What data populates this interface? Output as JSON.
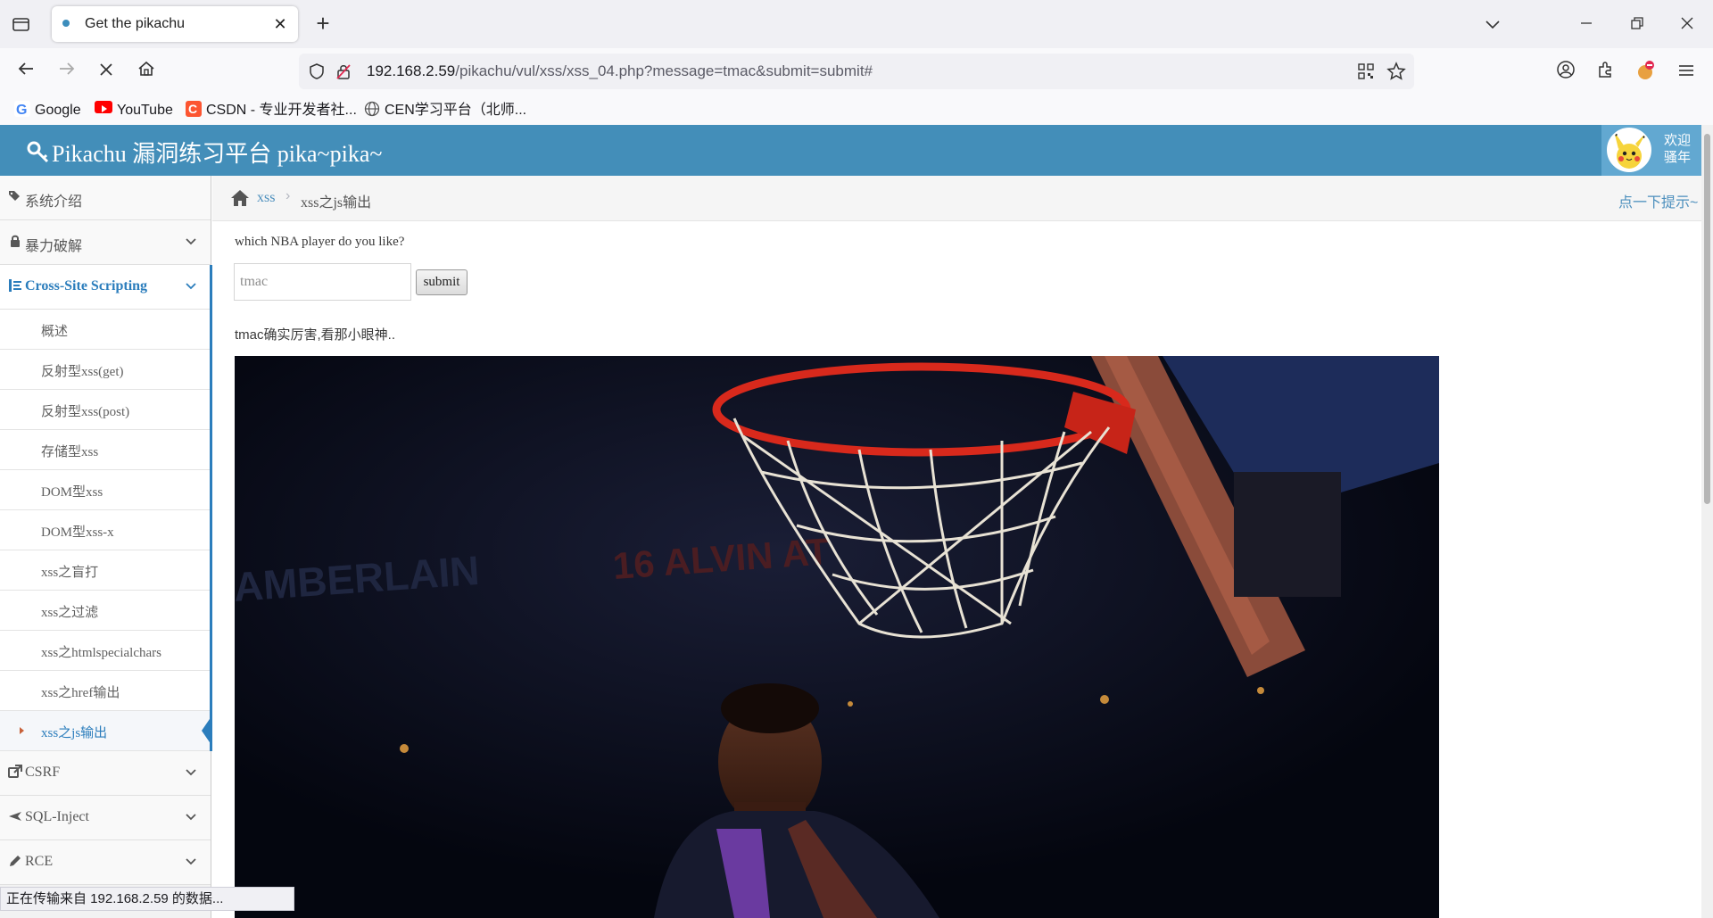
{
  "browser": {
    "tab": {
      "title": "Get the pikachu",
      "close": "✕"
    },
    "new_tab": "+",
    "url": {
      "host": "192.168.2.59",
      "path": "/pikachu/vul/xss/xss_04.php?message=tmac&submit=submit#"
    },
    "bookmarks": [
      {
        "label": "Google",
        "color": "#4285f4"
      },
      {
        "label": "YouTube",
        "color": "#ff0000"
      },
      {
        "label": "CSDN - 专业开发者社...",
        "color": "#fc5531"
      },
      {
        "label": "CEN学习平台（北师...",
        "color": "#555555"
      }
    ],
    "status": "正在传输来自 192.168.2.59 的数据..."
  },
  "site": {
    "title": "Pikachu 漏洞练习平台 pika~pika~",
    "user": {
      "line1": "欢迎",
      "line2": "骚年"
    }
  },
  "sidebar": {
    "items": [
      {
        "label": "系统介绍"
      },
      {
        "label": "暴力破解"
      },
      {
        "label": "Cross-Site Scripting"
      },
      {
        "label": "CSRF"
      },
      {
        "label": "SQL-Inject"
      },
      {
        "label": "RCE"
      }
    ],
    "xss_sub": [
      {
        "label": "概述"
      },
      {
        "label": "反射型xss(get)"
      },
      {
        "label": "反射型xss(post)"
      },
      {
        "label": "存储型xss"
      },
      {
        "label": "DOM型xss"
      },
      {
        "label": "DOM型xss-x"
      },
      {
        "label": "xss之盲打"
      },
      {
        "label": "xss之过滤"
      },
      {
        "label": "xss之htmlspecialchars"
      },
      {
        "label": "xss之href输出"
      },
      {
        "label": "xss之js输出"
      }
    ]
  },
  "breadcrumb": {
    "parent": "xss",
    "sep": "›",
    "current": "xss之js输出",
    "hint": "点一下提示~"
  },
  "form": {
    "question": "which NBA player do you like?",
    "input_value": "tmac",
    "submit_label": "submit"
  },
  "result": {
    "text": "tmac确实厉害,看那小眼神..",
    "photo_text_1": "AMBERLAIN",
    "photo_text_2": "16 ALVIN AT"
  },
  "colors": {
    "header": "#438eb9",
    "accent": "#2b7dbc"
  }
}
